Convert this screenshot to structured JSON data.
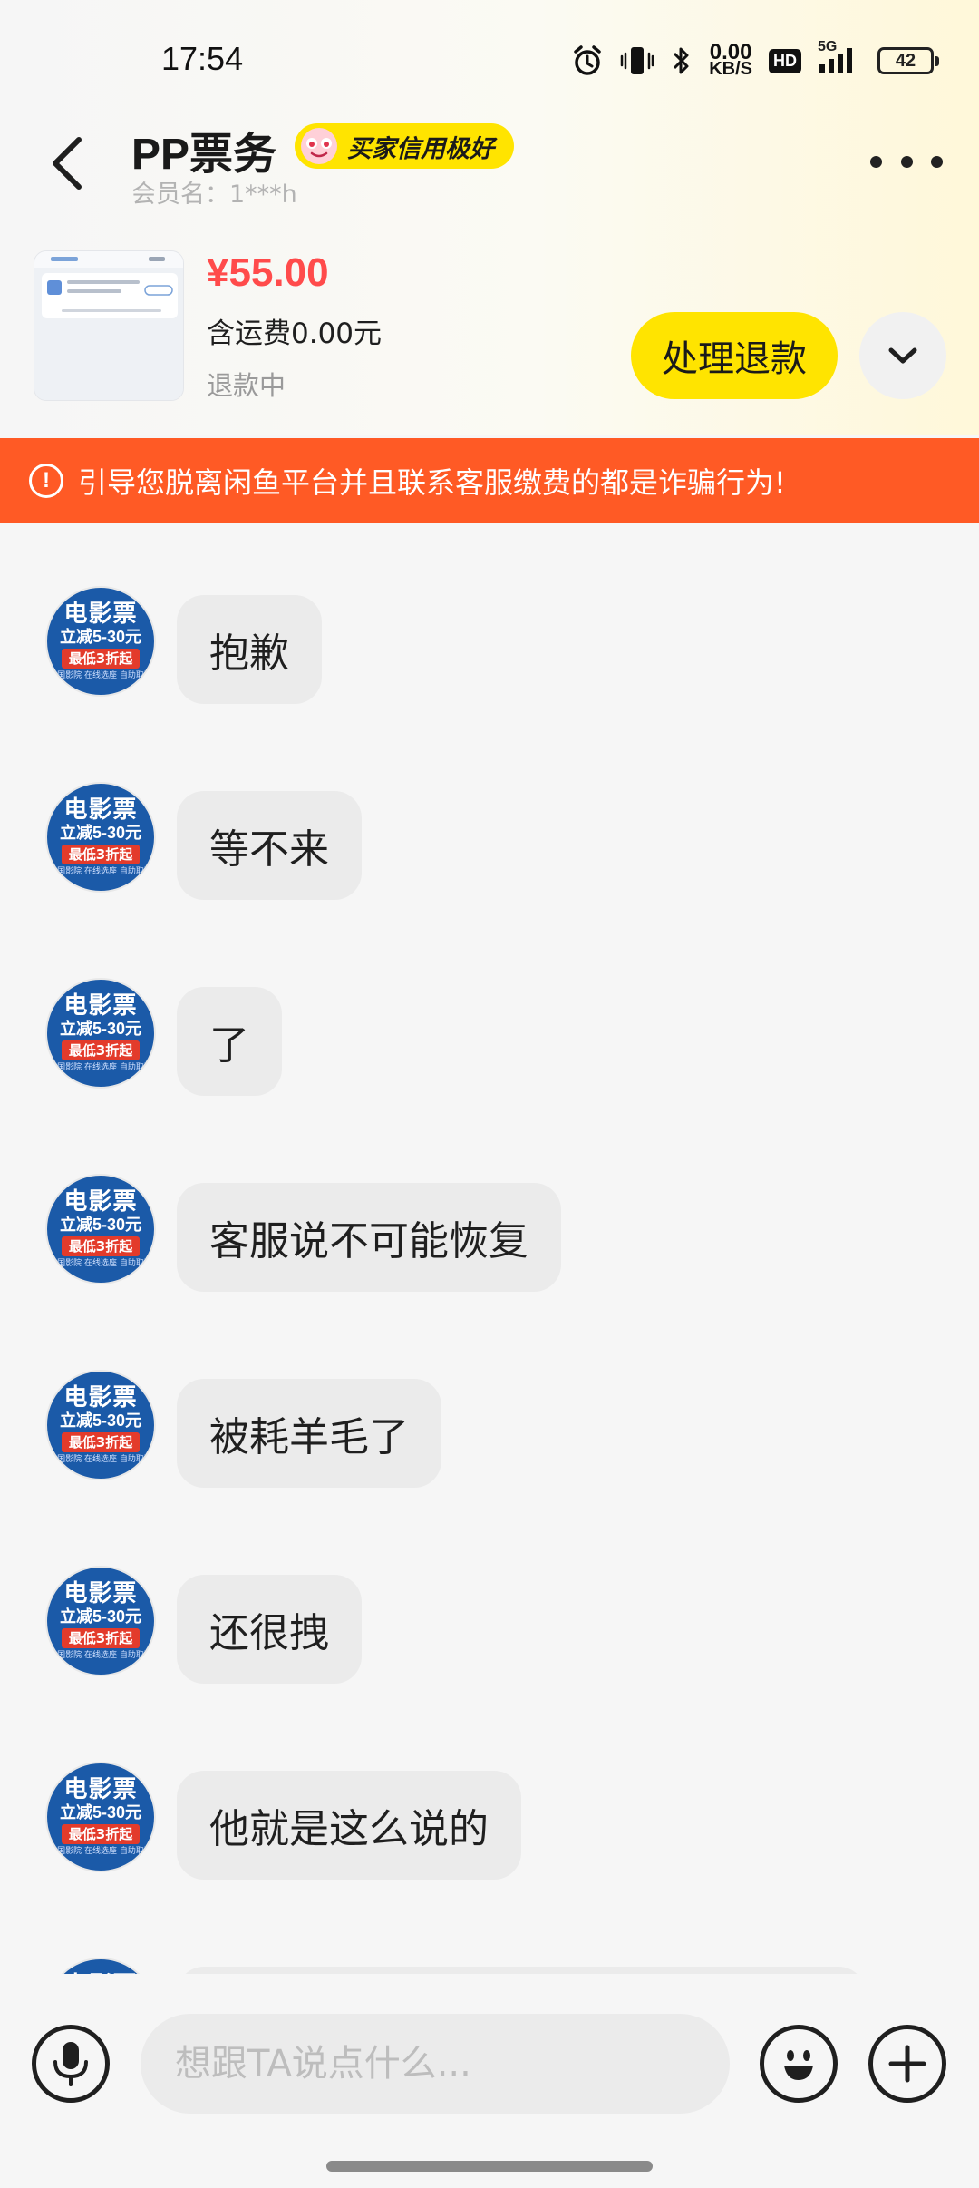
{
  "status_bar": {
    "time": "17:54",
    "net_speed_value": "0.00",
    "net_speed_unit": "KB/S",
    "hd_label": "HD",
    "network_type": "5G",
    "battery": "42"
  },
  "header": {
    "title": "PP票务",
    "credit_badge": "买家信用极好",
    "member_name": "会员名：1***h"
  },
  "order": {
    "price": "¥55.00",
    "shipping": "含运费0.00元",
    "status": "退款中",
    "refund_button": "处理退款"
  },
  "warning": {
    "icon": "!",
    "text": "引导您脱离闲鱼平台并且联系客服缴费的都是诈骗行为!"
  },
  "avatar": {
    "line1": "电影票",
    "line2": "立减5-30元",
    "line3": "最低3折起",
    "line4": "全国影院 在线选座 自助取票"
  },
  "messages": [
    {
      "text": "抱歉"
    },
    {
      "text": "等不来"
    },
    {
      "text": "了"
    },
    {
      "text": "客服说不可能恢复"
    },
    {
      "text": "被耗羊毛了"
    },
    {
      "text": "还很拽"
    },
    {
      "text": "他就是这么说的"
    }
  ],
  "input": {
    "placeholder": "想跟TA说点什么..."
  },
  "colors": {
    "accent_yellow": "#ffe400",
    "price_red": "#ff4b4b",
    "warning_orange": "#ff5a25",
    "avatar_blue": "#1b5aa8"
  },
  "icons": [
    "back-arrow-icon",
    "more-icon",
    "chevron-down-icon",
    "warning-icon",
    "microphone-icon",
    "emoji-icon",
    "plus-icon",
    "alarm-icon",
    "vibrate-icon",
    "bluetooth-icon",
    "signal-icon",
    "battery-icon"
  ]
}
